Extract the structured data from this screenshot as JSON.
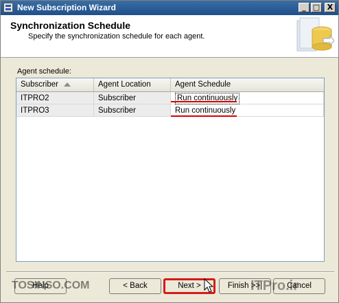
{
  "window": {
    "title": "New Subscription Wizard",
    "controls": {
      "minimize": "_",
      "maximize": "□",
      "close": "X"
    }
  },
  "header": {
    "title": "Synchronization Schedule",
    "subtitle": "Specify the synchronization schedule for each agent."
  },
  "agent_label": "Agent schedule:",
  "grid": {
    "columns": [
      "Subscriber",
      "Agent Location",
      "Agent Schedule"
    ],
    "rows": [
      {
        "subscriber": "ITPRO2",
        "location": "Subscriber",
        "schedule": "Run continuously"
      },
      {
        "subscriber": "ITPRO3",
        "location": "Subscriber",
        "schedule": "Run continuously"
      }
    ]
  },
  "buttons": {
    "help": "Help",
    "back": "< Back",
    "next": "Next >",
    "finish": "Finish >>|",
    "cancel": "Cancel"
  },
  "watermark": {
    "left": "TOSINSO.COM",
    "right": "ITPro.ir"
  },
  "colors": {
    "titlebar": "#3a6ea5",
    "highlight_red": "#d40000"
  }
}
